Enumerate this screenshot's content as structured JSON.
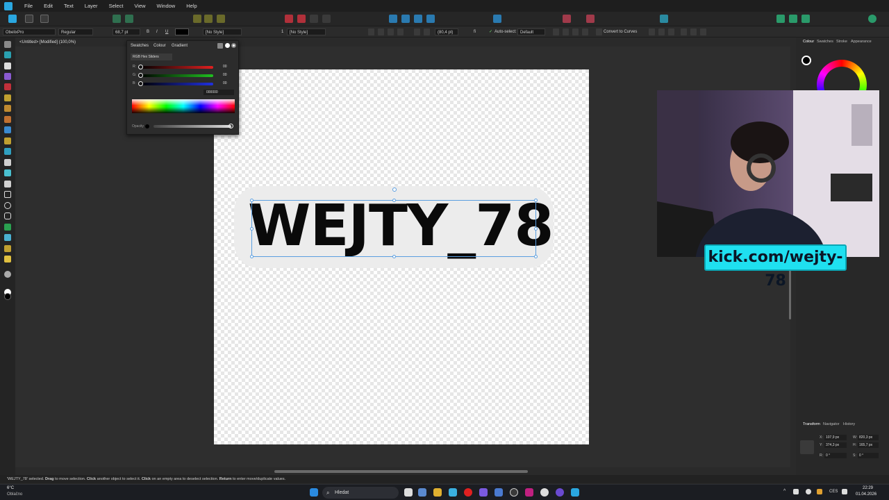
{
  "menu": [
    "File",
    "Edit",
    "Text",
    "Layer",
    "Select",
    "View",
    "Window",
    "Help"
  ],
  "context_toolbar": {
    "font_family": "ObelixPro",
    "font_style": "Regular",
    "font_size": "68,7 pt",
    "bold": "B",
    "italic": "I",
    "underline": "U",
    "char_style": "[No Style]",
    "para_style": "[No Style]",
    "para_num": "1",
    "leading": "(80,4 pt)",
    "fi": "fi",
    "auto_select_label": "Auto-select:",
    "auto_select_value": "Default",
    "convert_to_curves": "Convert to Curves"
  },
  "document": {
    "tab_title": "<Untitled> [Modified] (100,0%)",
    "text": "WEJTY_78"
  },
  "colour_popup": {
    "tabs": [
      "Swatches",
      "Colour",
      "Gradient"
    ],
    "mode": "RGB Hex Sliders",
    "sliders": [
      {
        "label": "R:",
        "value": "00",
        "color": "#e02020"
      },
      {
        "label": "G:",
        "value": "00",
        "color": "#20c020"
      },
      {
        "label": "B:",
        "value": "00",
        "color": "#2030e0"
      }
    ],
    "hex": "000000",
    "opacity_label": "Opacity"
  },
  "right_panel": {
    "top_tabs": [
      "Colour",
      "Swatches",
      "Stroke",
      "Appearance"
    ],
    "bottom_tabs": [
      "Transform",
      "Navigator",
      "History"
    ],
    "transform": [
      {
        "label": "X:",
        "value": "107,9 px"
      },
      {
        "label": "W:",
        "value": "820,3 px"
      },
      {
        "label": "Y:",
        "value": "374,3 px"
      },
      {
        "label": "H:",
        "value": "165,7 px"
      },
      {
        "label": "R:",
        "value": "0 °"
      },
      {
        "label": "S:",
        "value": "0 °"
      }
    ]
  },
  "overlay": {
    "kick_url": "kick.com/wejty-78"
  },
  "status": {
    "obj": "'WEJTY_78' selected.",
    "b1": "Drag",
    "t1": " to move selection. ",
    "b2": "Click",
    "t2": " another object to select it. ",
    "b3": "Click",
    "t3": " on an empty area to deselect selection. ",
    "b4": "Return",
    "t4": " to enter move/duplicate values."
  },
  "taskbar": {
    "weather_temp": "6°C",
    "weather_desc": "Oblačno",
    "search": "Hledat",
    "lang": "CES",
    "time": "22:29",
    "date": "01.04.2026"
  }
}
